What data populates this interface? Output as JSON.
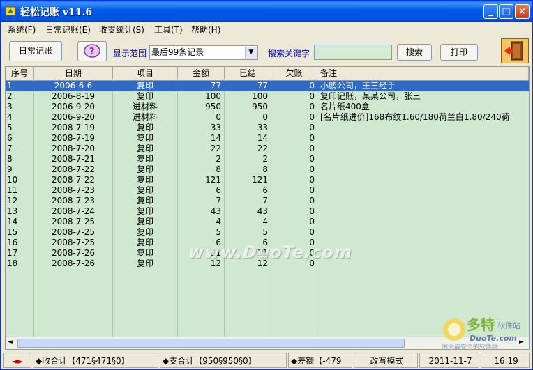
{
  "window": {
    "title": "轻松记账  v11.6",
    "minimize": "_",
    "maximize": "□",
    "close": "×"
  },
  "menu": [
    "系统(F)",
    "日常记账(E)",
    "收支统计(S)",
    "工具(T)",
    "帮助(H)"
  ],
  "toolbar": {
    "daily_btn": "日常记账",
    "range_label": "显示范围",
    "range_value": "最后99条记录",
    "search_label": "搜索关键字",
    "search_value": "",
    "search_btn": "搜索",
    "print_btn": "打印"
  },
  "table": {
    "headers": [
      "序号",
      "日期",
      "项目",
      "金额",
      "已结",
      "欠账",
      "备注"
    ],
    "rows": [
      [
        "1",
        "2006-6-6",
        "复印",
        "77",
        "77",
        "0",
        "小鹏公司，王三经手"
      ],
      [
        "2",
        "2006-8-19",
        "复印",
        "100",
        "100",
        "0",
        "复印记账，某某公司，张三"
      ],
      [
        "3",
        "2006-9-20",
        "进材料",
        "950",
        "950",
        "0",
        "名片纸400盒"
      ],
      [
        "4",
        "2006-9-20",
        "进材料",
        "0",
        "0",
        "0",
        "[名片纸进价]168布纹1.60/180荷兰白1.80/240荷"
      ],
      [
        "5",
        "2008-7-19",
        "复印",
        "33",
        "33",
        "0",
        ""
      ],
      [
        "6",
        "2008-7-19",
        "复印",
        "14",
        "14",
        "0",
        ""
      ],
      [
        "7",
        "2008-7-20",
        "复印",
        "22",
        "22",
        "0",
        ""
      ],
      [
        "8",
        "2008-7-21",
        "复印",
        "2",
        "2",
        "0",
        ""
      ],
      [
        "9",
        "2008-7-22",
        "复印",
        "8",
        "8",
        "0",
        ""
      ],
      [
        "10",
        "2008-7-22",
        "复印",
        "121",
        "121",
        "0",
        ""
      ],
      [
        "11",
        "2008-7-23",
        "复印",
        "6",
        "6",
        "0",
        ""
      ],
      [
        "12",
        "2008-7-23",
        "复印",
        "7",
        "7",
        "0",
        ""
      ],
      [
        "13",
        "2008-7-24",
        "复印",
        "43",
        "43",
        "0",
        ""
      ],
      [
        "14",
        "2008-7-25",
        "复印",
        "4",
        "4",
        "0",
        ""
      ],
      [
        "15",
        "2008-7-25",
        "复印",
        "5",
        "5",
        "0",
        ""
      ],
      [
        "16",
        "2008-7-25",
        "复印",
        "6",
        "6",
        "0",
        ""
      ],
      [
        "17",
        "2008-7-26",
        "复印",
        "11",
        "11",
        "0",
        ""
      ],
      [
        "18",
        "2008-7-26",
        "复印",
        "12",
        "12",
        "0",
        ""
      ]
    ],
    "selected_row": 0
  },
  "status": {
    "income": "◆收合计【471§471§0】",
    "expense": "◆支合计【950§950§0】",
    "diff": "◆差额【-479",
    "mode": "改写模式",
    "date": "2011-11-7",
    "time": "16:19"
  },
  "watermark": "www.DuoTe.com",
  "logo": {
    "text": "多特",
    "sub": "软件站",
    "domain": "DuoTe.com",
    "tagline": "国内最安全的软件站"
  }
}
